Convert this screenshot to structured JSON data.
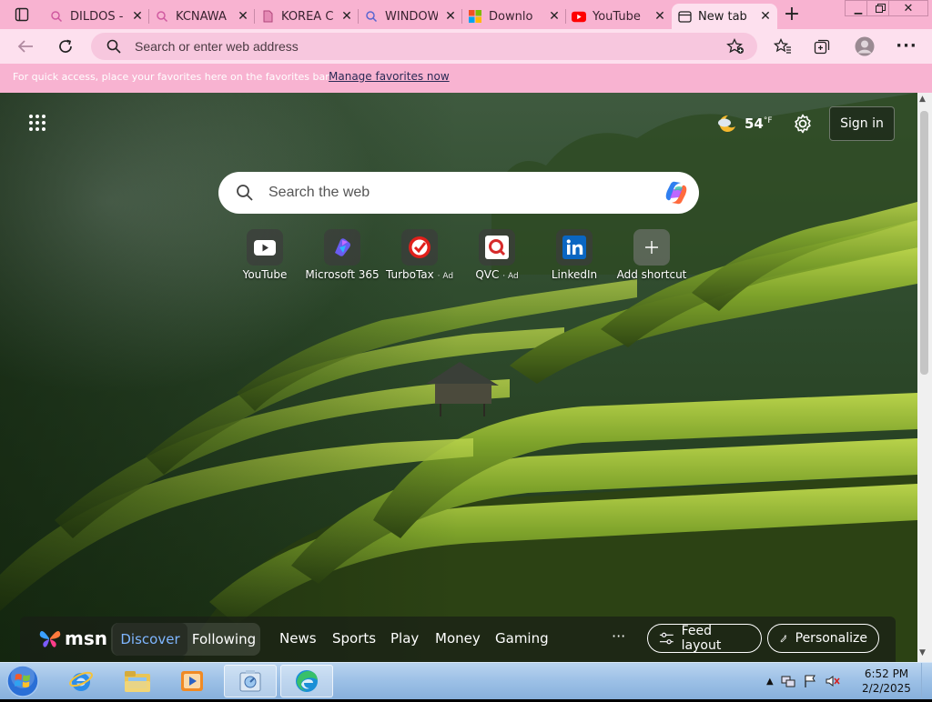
{
  "tabs": [
    {
      "label": "DILDOS -",
      "favicon": "search-icon"
    },
    {
      "label": "KCNAWA",
      "favicon": "search-icon"
    },
    {
      "label": "KOREA C",
      "favicon": "page-icon"
    },
    {
      "label": "WINDOW",
      "favicon": "search-icon"
    },
    {
      "label": "Downlo",
      "favicon": "microsoft-icon"
    },
    {
      "label": "YouTube",
      "favicon": "youtube-icon"
    },
    {
      "label": "New tab",
      "favicon": "newtab-icon"
    }
  ],
  "address_bar": {
    "placeholder": "Search or enter web address"
  },
  "favorites_bar": {
    "message": "For quick access, place your favorites here on the favorites bar.",
    "link": "Manage favorites now"
  },
  "newtab": {
    "weather": {
      "temp": "54",
      "unit": "°F",
      "icon": "moon-cloud-icon"
    },
    "signin": "Sign in",
    "search_placeholder": "Search the web",
    "shortcuts": [
      {
        "name": "YouTube",
        "ad": ""
      },
      {
        "name": "Microsoft 365",
        "ad": ""
      },
      {
        "name": "TurboTax",
        "ad": "· Ad"
      },
      {
        "name": "QVC",
        "ad": "· Ad"
      },
      {
        "name": "LinkedIn",
        "ad": ""
      },
      {
        "name": "Add shortcut",
        "ad": ""
      }
    ]
  },
  "msn": {
    "logo": "msn",
    "discover": "Discover",
    "following": "Following",
    "nav": [
      "News",
      "Sports",
      "Play",
      "Money",
      "Gaming"
    ],
    "more": "···",
    "feed_layout": "Feed layout",
    "personalize": "Personalize"
  },
  "taskbar": {
    "time": "6:52 PM",
    "date": "2/2/2025"
  },
  "colors": {
    "tabstrip": "#f8b3d1",
    "toolbar": "#fde0ee",
    "accent_link": "#7fb6ff"
  }
}
